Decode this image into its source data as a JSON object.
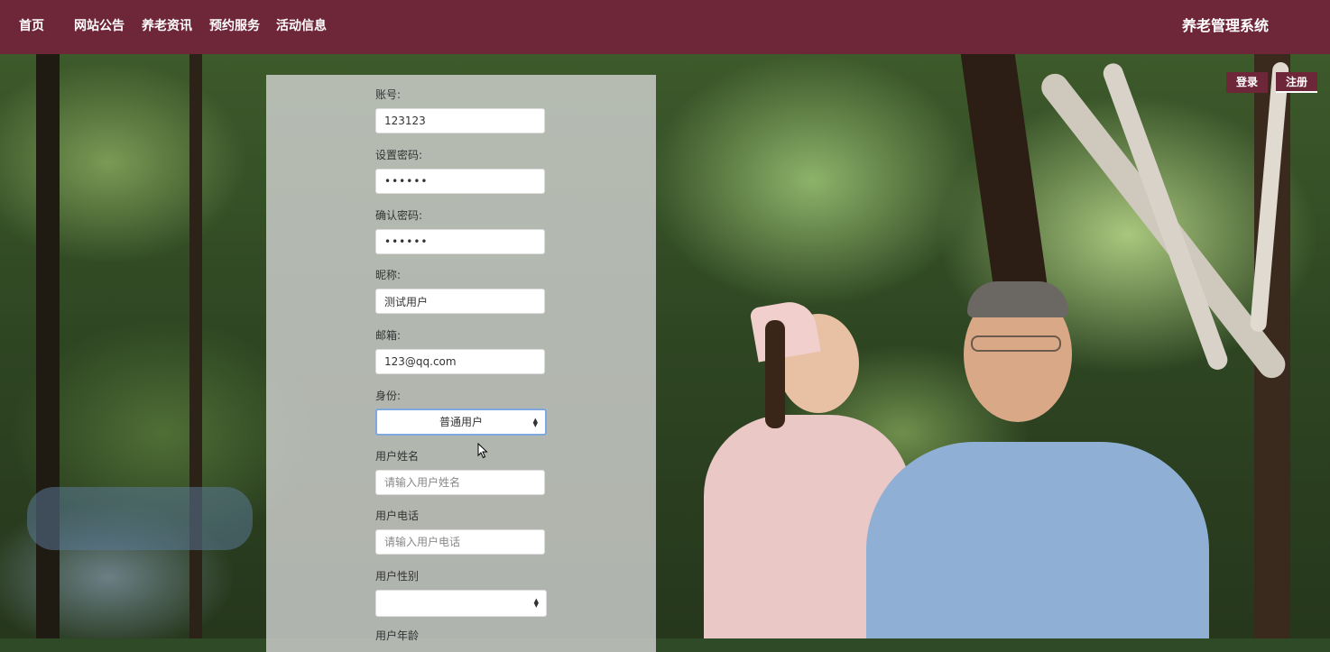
{
  "nav": {
    "items": [
      {
        "label": "首页"
      },
      {
        "label": "网站公告"
      },
      {
        "label": "养老资讯"
      },
      {
        "label": "预约服务"
      },
      {
        "label": "活动信息"
      }
    ],
    "site_title": "养老管理系统"
  },
  "auth": {
    "login_label": "登录",
    "register_label": "注册"
  },
  "form": {
    "account": {
      "label": "账号:",
      "value": "123123"
    },
    "password": {
      "label": "设置密码:",
      "value": "••••••"
    },
    "confirm_password": {
      "label": "确认密码:",
      "value": "••••••"
    },
    "nickname": {
      "label": "昵称:",
      "value": "测试用户"
    },
    "email": {
      "label": "邮箱:",
      "value": "123@qq.com"
    },
    "identity": {
      "label": "身份:",
      "value": "普通用户"
    },
    "user_name": {
      "label": "用户姓名",
      "placeholder": "请输入用户姓名"
    },
    "user_phone": {
      "label": "用户电话",
      "placeholder": "请输入用户电话"
    },
    "user_gender": {
      "label": "用户性别",
      "value": ""
    },
    "user_age": {
      "label": "用户年龄"
    }
  },
  "colors": {
    "brand": "#6e2639",
    "panel": "#d7d7d7",
    "focus": "#7fa7e0"
  }
}
